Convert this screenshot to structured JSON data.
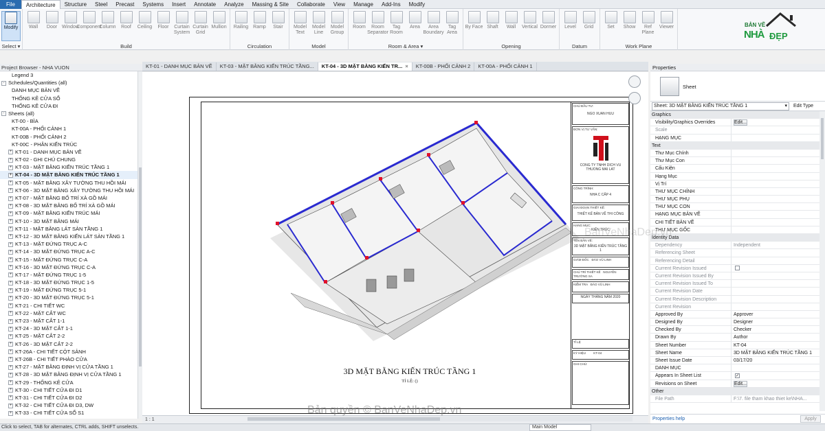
{
  "menubar": {
    "items": [
      "File",
      "Architecture",
      "Structure",
      "Steel",
      "Precast",
      "Systems",
      "Insert",
      "Annotate",
      "Analyze",
      "Massing & Site",
      "Collaborate",
      "View",
      "Manage",
      "Add-Ins",
      "Modify"
    ]
  },
  "ribbon": {
    "select": {
      "modify_label": "Modify",
      "group_label": "Select ▾"
    },
    "build": {
      "tools": [
        "Wall",
        "Door",
        "Window",
        "Component",
        "Column",
        "Roof",
        "Ceiling",
        "Floor",
        "Curtain System",
        "Curtain Grid",
        "Mullion"
      ],
      "group_label": "Build"
    },
    "circulation": {
      "tools": [
        "Railing",
        "Ramp",
        "Stair"
      ],
      "group_label": "Circulation"
    },
    "model": {
      "tools": [
        "Model Text",
        "Model Line",
        "Model Group"
      ],
      "group_label": "Model"
    },
    "room_area": {
      "tools": [
        "Room",
        "Room Separator",
        "Tag Room",
        "Area",
        "Area Boundary",
        "Tag Area"
      ],
      "group_label": "Room & Area ▾"
    },
    "opening": {
      "tools": [
        "By Face",
        "Shaft",
        "Wall",
        "Vertical",
        "Dormer"
      ],
      "group_label": "Opening"
    },
    "datum": {
      "tools": [
        "Level",
        "Grid"
      ],
      "group_label": "Datum"
    },
    "work_plane": {
      "tools": [
        "Set",
        "Show",
        "Ref Plane",
        "Viewer"
      ],
      "group_label": "Work Plane"
    }
  },
  "logo": {
    "line1": "BẢN VẼ",
    "line2": "NHÀ",
    "line3": "ĐẸP"
  },
  "project_browser": {
    "title": "Project Browser - NHA VUON",
    "items": [
      {
        "label": "Legend 3",
        "indent": 3,
        "exp": ""
      },
      {
        "label": "Schedules/Quantities (all)",
        "indent": 0,
        "exp": "-"
      },
      {
        "label": "DANH MỤC BẢN VẼ",
        "indent": 3,
        "exp": ""
      },
      {
        "label": "THỐNG KÊ CỬA SỔ",
        "indent": 3,
        "exp": ""
      },
      {
        "label": "THỐNG KÊ CỬA ĐI",
        "indent": 3,
        "exp": ""
      },
      {
        "label": "Sheets (all)",
        "indent": 0,
        "exp": "-"
      },
      {
        "label": "KT-00 - BÌA",
        "indent": 3,
        "exp": ""
      },
      {
        "label": "KT-00A - PHỐI CẢNH 1",
        "indent": 3,
        "exp": ""
      },
      {
        "label": "KT-00B - PHỐI CẢNH 2",
        "indent": 3,
        "exp": ""
      },
      {
        "label": "KT-00C - PHÂN KIẾN TRÚC",
        "indent": 3,
        "exp": ""
      },
      {
        "label": "KT-01 - DANH MỤC BẢN VẼ",
        "indent": 2,
        "exp": "+"
      },
      {
        "label": "KT-02 - GHI CHÚ CHUNG",
        "indent": 2,
        "exp": "+"
      },
      {
        "label": "KT-03 - MẶT BẰNG KIẾN TRÚC TẦNG 1",
        "indent": 2,
        "exp": "+"
      },
      {
        "label": "KT-04 - 3D MẶT BẰNG KIẾN TRÚC TẦNG 1",
        "indent": 2,
        "exp": "+",
        "selected": true
      },
      {
        "label": "KT-05 - MẶT BẰNG XÂY TƯỜNG THU HỒI MÁI",
        "indent": 2,
        "exp": "+"
      },
      {
        "label": "KT-06 - 3D MẶT BẰNG XÂY TƯỜNG THU HỒI MÁI",
        "indent": 2,
        "exp": "+"
      },
      {
        "label": "KT-07 - MẶT BẰNG BỐ TRÍ XÀ GỒ MÁI",
        "indent": 2,
        "exp": "+"
      },
      {
        "label": "KT-08 - 3D MẶT BẰNG BỐ TRÍ XÀ GỒ MÁI",
        "indent": 2,
        "exp": "+"
      },
      {
        "label": "KT-09 - MẶT BẰNG KIẾN TRÚC MÁI",
        "indent": 2,
        "exp": "+"
      },
      {
        "label": "KT-10 - 3D MẶT BẰNG MÁI",
        "indent": 2,
        "exp": "+"
      },
      {
        "label": "KT-11 - MẶT BẰNG LÁT SÀN TẦNG 1",
        "indent": 2,
        "exp": "+"
      },
      {
        "label": "KT-12 - 3D MẶT BẰNG KIẾN LÁT SÀN TẦNG 1",
        "indent": 2,
        "exp": "+"
      },
      {
        "label": "KT-13 - MẶT ĐỨNG TRỤC A-C",
        "indent": 2,
        "exp": "+"
      },
      {
        "label": "KT-14 - 3D MẶT ĐỨNG TRỤC A-C",
        "indent": 2,
        "exp": "+"
      },
      {
        "label": "KT-15 - MẶT ĐỨNG TRỤC C-A",
        "indent": 2,
        "exp": "+"
      },
      {
        "label": "KT-16 - 3D MẶT ĐỨNG TRỤC C-A",
        "indent": 2,
        "exp": "+"
      },
      {
        "label": "KT-17 - MẶT ĐỨNG TRỤC 1-5",
        "indent": 2,
        "exp": "+"
      },
      {
        "label": "KT-18 - 3D MẶT ĐỨNG TRỤC 1-5",
        "indent": 2,
        "exp": "+"
      },
      {
        "label": "KT-19 - MẶT ĐỨNG TRỤC 5-1",
        "indent": 2,
        "exp": "+"
      },
      {
        "label": "KT-20 - 3D MẶT ĐỨNG TRỤC 5-1",
        "indent": 2,
        "exp": "+"
      },
      {
        "label": "KT-21 - CHI TIẾT WC",
        "indent": 2,
        "exp": "+"
      },
      {
        "label": "KT-22 - MẶT CẮT WC",
        "indent": 2,
        "exp": "+"
      },
      {
        "label": "KT-23 - MẶT CẮT 1-1",
        "indent": 2,
        "exp": "+"
      },
      {
        "label": "KT-24 - 3D MẶT CẮT 1-1",
        "indent": 2,
        "exp": "+"
      },
      {
        "label": "KT-25 - MẶT CẮT 2-2",
        "indent": 2,
        "exp": "+"
      },
      {
        "label": "KT-26 - 3D MẶT CẮT 2-2",
        "indent": 2,
        "exp": "+"
      },
      {
        "label": "KT-26A - CHI TIẾT CỘT SẢNH",
        "indent": 2,
        "exp": "+"
      },
      {
        "label": "KT-26B - CHI TIẾT PHÀO CỬA",
        "indent": 2,
        "exp": "+"
      },
      {
        "label": "KT-27 - MẶT BẰNG ĐỊNH VỊ CỬA TẦNG 1",
        "indent": 2,
        "exp": "+"
      },
      {
        "label": "KT-28 - 3D MẶT BẰNG ĐỊNH VỊ CỬA TẦNG 1",
        "indent": 2,
        "exp": "+"
      },
      {
        "label": "KT-29 - THỐNG KÊ CỬA",
        "indent": 2,
        "exp": "+"
      },
      {
        "label": "KT-30 - CHI TIẾT CỬA ĐI D1",
        "indent": 2,
        "exp": "+"
      },
      {
        "label": "KT-31 - CHI TIẾT CỬA ĐI D2",
        "indent": 2,
        "exp": "+"
      },
      {
        "label": "KT-32 - CHI TIẾT CỬA ĐI D3, DW",
        "indent": 2,
        "exp": "+"
      },
      {
        "label": "KT-33 - CHI TIẾT CỬA SỔ S1",
        "indent": 2,
        "exp": "+"
      }
    ]
  },
  "view_tabs": [
    {
      "label": "KT-01 - DANH MỤC BẢN VẼ",
      "active": false
    },
    {
      "label": "KT-03 - MẶT BẰNG KIẾN TRÚC TẦNG...",
      "active": false
    },
    {
      "label": "KT-04 - 3D MẶT BẰNG KIẾN TR...",
      "active": true
    },
    {
      "label": "KT-00B - PHỐI CẢNH 2",
      "active": false
    },
    {
      "label": "KT-00A - PHỐI CẢNH 1",
      "active": false
    }
  ],
  "sheet": {
    "title": "3D MẶT BẰNG KIẾN TRÚC TẦNG 1",
    "scale": "TỈ LỆ: ()",
    "title_block": {
      "owner_label": "CHỦ ĐẦU TƯ:",
      "owner": "NGO XUAN HUU",
      "company_label": "ĐƠN VỊ TƯ VẤN:",
      "company": "CONG TY TNHH DICH VU THUONG MAI LAT",
      "project_label": "CÔNG TRÌNH:",
      "project": "NHA C CẤP 4",
      "stage_label": "GIAI ĐOẠN THIẾT KẾ:",
      "stage": "THIẾT KẾ BẢN VẼ THI CÔNG",
      "category_label": "HẠNG MỤC:",
      "category": "KIẾN TRÚC",
      "sheet_label": "TÊN BẢN VẼ:",
      "sheet_name": "3D MẶT BẰNG KIẾN TRÚC TẦNG 1",
      "director_label": "GIÁM ĐỐC",
      "director": "ĐÀO VŨ LINH",
      "chief_label": "CHỦ TRÌ THIẾT KẾ",
      "chief": "NGUYỄN TRƯỜNG SA",
      "checker_label": "KIỂM TRA",
      "checker": "ĐÀO VŨ LINH",
      "date_line": "NGÀY    THÁNG    NĂM 2020",
      "ty_le_label": "TỈ LỆ",
      "so_ban_ve_label": "KÝ HIỆU",
      "sheet_no": "KT-04",
      "notes_label": "GHI CHÚ:"
    }
  },
  "viewbar": {
    "scale": "1 : 1"
  },
  "properties": {
    "title": "Properties",
    "type_name": "Sheet",
    "selector": "Sheet: 3D MẶT BẰNG KIẾN TRÚC TẦNG 1",
    "edit_type": "Edit Type",
    "rows": [
      {
        "section": "Graphics"
      },
      {
        "k": "Visibility/Graphics Overrides",
        "btn": "Edit..."
      },
      {
        "k": "Scale",
        "v": "",
        "grey": true
      },
      {
        "k": "HẠNG MỤC",
        "v": ""
      },
      {
        "section": "Text"
      },
      {
        "k": "Thư Mục Chính",
        "v": ""
      },
      {
        "k": "Thư Mục Con",
        "v": ""
      },
      {
        "k": "Cấu Kiện",
        "v": ""
      },
      {
        "k": "Hạng Mục",
        "v": ""
      },
      {
        "k": "Vị Trí",
        "v": ""
      },
      {
        "k": "THƯ MỤC CHÍNH",
        "v": ""
      },
      {
        "k": "THƯ MỤC PHỤ",
        "v": ""
      },
      {
        "k": "THƯ MỤC CON",
        "v": ""
      },
      {
        "k": "HẠNG MỤC BẢN VẼ",
        "v": ""
      },
      {
        "k": "CHI TIẾT BẢN VẼ",
        "v": ""
      },
      {
        "k": "THƯ MỤC GỐC",
        "v": ""
      },
      {
        "section": "Identity Data"
      },
      {
        "k": "Dependency",
        "v": "Independent",
        "grey": true
      },
      {
        "k": "Referencing Sheet",
        "v": "",
        "grey": true
      },
      {
        "k": "Referencing Detail",
        "v": "",
        "grey": true
      },
      {
        "k": "Current Revision Issued",
        "v": "",
        "grey": true,
        "chk": true
      },
      {
        "k": "Current Revision Issued By",
        "v": "",
        "grey": true
      },
      {
        "k": "Current Revision Issued To",
        "v": "",
        "grey": true
      },
      {
        "k": "Current Revision Date",
        "v": "",
        "grey": true
      },
      {
        "k": "Current Revision Description",
        "v": "",
        "grey": true
      },
      {
        "k": "Current Revision",
        "v": "",
        "grey": true
      },
      {
        "k": "Approved By",
        "v": "Approver"
      },
      {
        "k": "Designed By",
        "v": "Designer"
      },
      {
        "k": "Checked By",
        "v": "Checker"
      },
      {
        "k": "Drawn By",
        "v": "Author"
      },
      {
        "k": "Sheet Number",
        "v": "KT-04"
      },
      {
        "k": "Sheet Name",
        "v": "3D MẶT BẰNG KIẾN TRÚC TẦNG 1"
      },
      {
        "k": "Sheet Issue Date",
        "v": "03/17/20"
      },
      {
        "k": "DANH MỤC",
        "v": ""
      },
      {
        "k": "Appears In Sheet List",
        "v": "",
        "chk": true,
        "checked": true
      },
      {
        "k": "Revisions on Sheet",
        "btn": "Edit..."
      },
      {
        "section": "Other"
      },
      {
        "k": "File Path",
        "v": "F:\\7. file tham khao thiet ke\\NHA...",
        "grey": true
      }
    ],
    "help_link": "Properties help",
    "apply": "Apply"
  },
  "statusbar": {
    "text": "Click to select, TAB for alternates, CTRL adds, SHIFT unselects.",
    "model": "Main Model"
  },
  "watermark": "Bản quyền © BanVeNhaDep.vn",
  "watermark2": "BanVeNhaDep.vn",
  "colors": {
    "accent": "#2b6cb0",
    "wall_blue": "#2a2ad0",
    "wall_red": "#e0102a",
    "logo_green": "#1f9a3f"
  }
}
